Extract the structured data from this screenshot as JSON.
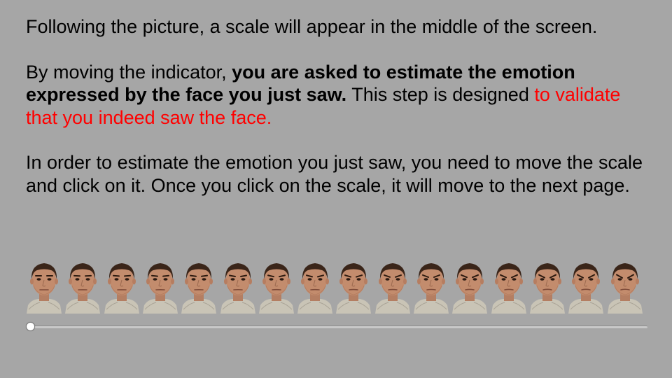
{
  "instructions": {
    "p1": "Following the picture, a scale will appear in the middle of the screen.",
    "p2_start": "By moving the indicator, ",
    "p2_bold": "you are asked to estimate the emotion expressed by the face you just saw.",
    "p2_mid": " This step is designed ",
    "p2_red": "to validate that you indeed saw the face.",
    "p3": "In order to estimate the emotion you just saw, you need to move the scale and click on it. Once you click on the scale, it will move to the next page."
  },
  "faces": {
    "count": 16,
    "icon": "face-morph-icon",
    "progression": "neutral-to-angry"
  },
  "slider": {
    "value": 0,
    "min": 0,
    "max": 1
  },
  "colors": {
    "background": "#a6a6a6",
    "text": "#000000",
    "highlight": "#ff0000",
    "thumb": "#ffffff",
    "track": "#c8c8c8"
  }
}
